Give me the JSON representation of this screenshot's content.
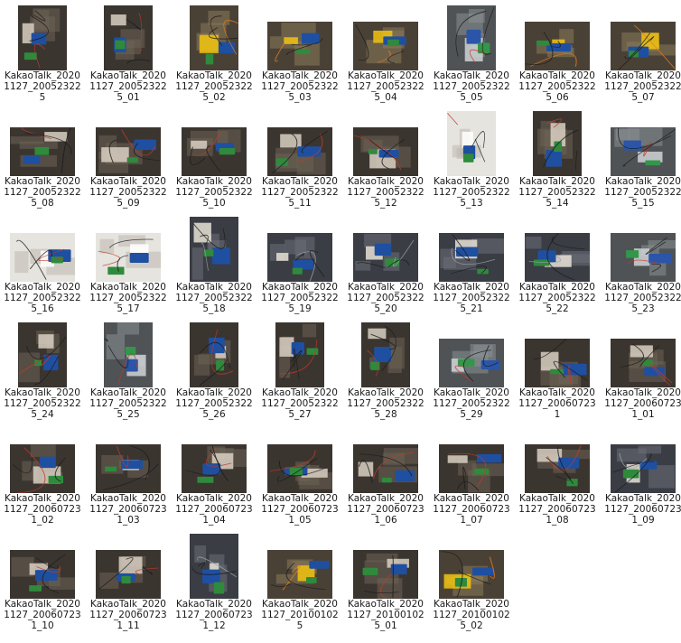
{
  "files": [
    {
      "line1": "KakaoTalk_2020",
      "line2": "1127_20052322",
      "line3": "5",
      "orient": "portrait",
      "palette": "desk"
    },
    {
      "line1": "KakaoTalk_2020",
      "line2": "1127_20052322",
      "line3": "5_01",
      "orient": "portrait",
      "palette": "desk"
    },
    {
      "line1": "KakaoTalk_2020",
      "line2": "1127_20052322",
      "line3": "5_02",
      "orient": "portrait",
      "palette": "yellow"
    },
    {
      "line1": "KakaoTalk_2020",
      "line2": "1127_20052322",
      "line3": "5_03",
      "orient": "landscape",
      "palette": "yellow"
    },
    {
      "line1": "KakaoTalk_2020",
      "line2": "1127_20052322",
      "line3": "5_04",
      "orient": "landscape",
      "palette": "yellow"
    },
    {
      "line1": "KakaoTalk_2020",
      "line2": "1127_20052322",
      "line3": "5_05",
      "orient": "portrait",
      "palette": "gray"
    },
    {
      "line1": "KakaoTalk_2020",
      "line2": "1127_20052322",
      "line3": "5_06",
      "orient": "landscape",
      "palette": "yellow"
    },
    {
      "line1": "KakaoTalk_2020",
      "line2": "1127_20052322",
      "line3": "5_07",
      "orient": "landscape",
      "palette": "yellow"
    },
    {
      "line1": "KakaoTalk_2020",
      "line2": "1127_20052322",
      "line3": "5_08",
      "orient": "landscape",
      "palette": "desk"
    },
    {
      "line1": "KakaoTalk_2020",
      "line2": "1127_20052322",
      "line3": "5_09",
      "orient": "landscape",
      "palette": "desk"
    },
    {
      "line1": "KakaoTalk_2020",
      "line2": "1127_20052322",
      "line3": "5_10",
      "orient": "landscape",
      "palette": "desk"
    },
    {
      "line1": "KakaoTalk_2020",
      "line2": "1127_20052322",
      "line3": "5_11",
      "orient": "landscape",
      "palette": "desk"
    },
    {
      "line1": "KakaoTalk_2020",
      "line2": "1127_20052322",
      "line3": "5_12",
      "orient": "landscape",
      "palette": "desk"
    },
    {
      "line1": "KakaoTalk_2020",
      "line2": "1127_20052322",
      "line3": "5_13",
      "orient": "portrait",
      "palette": "white"
    },
    {
      "line1": "KakaoTalk_2020",
      "line2": "1127_20052322",
      "line3": "5_14",
      "orient": "portrait",
      "palette": "desk"
    },
    {
      "line1": "KakaoTalk_2020",
      "line2": "1127_20052322",
      "line3": "5_15",
      "orient": "landscape",
      "palette": "gray"
    },
    {
      "line1": "KakaoTalk_2020",
      "line2": "1127_20052322",
      "line3": "5_16",
      "orient": "landscape",
      "palette": "white"
    },
    {
      "line1": "KakaoTalk_2020",
      "line2": "1127_20052322",
      "line3": "5_17",
      "orient": "landscape",
      "palette": "white"
    },
    {
      "line1": "KakaoTalk_2020",
      "line2": "1127_20052322",
      "line3": "5_18",
      "orient": "portrait",
      "palette": "keyboard"
    },
    {
      "line1": "KakaoTalk_2020",
      "line2": "1127_20052322",
      "line3": "5_19",
      "orient": "landscape",
      "palette": "keyboard"
    },
    {
      "line1": "KakaoTalk_2020",
      "line2": "1127_20052322",
      "line3": "5_20",
      "orient": "landscape",
      "palette": "keyboard"
    },
    {
      "line1": "KakaoTalk_2020",
      "line2": "1127_20052322",
      "line3": "5_21",
      "orient": "landscape",
      "palette": "keyboard"
    },
    {
      "line1": "KakaoTalk_2020",
      "line2": "1127_20052322",
      "line3": "5_22",
      "orient": "landscape",
      "palette": "keyboard"
    },
    {
      "line1": "KakaoTalk_2020",
      "line2": "1127_20052322",
      "line3": "5_23",
      "orient": "landscape",
      "palette": "gray"
    },
    {
      "line1": "KakaoTalk_2020",
      "line2": "1127_20052322",
      "line3": "5_24",
      "orient": "portrait",
      "palette": "desk"
    },
    {
      "line1": "KakaoTalk_2020",
      "line2": "1127_20052322",
      "line3": "5_25",
      "orient": "portrait",
      "palette": "gray"
    },
    {
      "line1": "KakaoTalk_2020",
      "line2": "1127_20052322",
      "line3": "5_26",
      "orient": "portrait",
      "palette": "desk"
    },
    {
      "line1": "KakaoTalk_2020",
      "line2": "1127_20052322",
      "line3": "5_27",
      "orient": "portrait",
      "palette": "desk"
    },
    {
      "line1": "KakaoTalk_2020",
      "line2": "1127_20052322",
      "line3": "5_28",
      "orient": "portrait",
      "palette": "desk"
    },
    {
      "line1": "KakaoTalk_2020",
      "line2": "1127_20052322",
      "line3": "5_29",
      "orient": "landscape",
      "palette": "gray"
    },
    {
      "line1": "KakaoTalk_2020",
      "line2": "1127_20060723",
      "line3": "1",
      "orient": "landscape",
      "palette": "desk"
    },
    {
      "line1": "KakaoTalk_2020",
      "line2": "1127_20060723",
      "line3": "1_01",
      "orient": "landscape",
      "palette": "desk"
    },
    {
      "line1": "KakaoTalk_2020",
      "line2": "1127_20060723",
      "line3": "1_02",
      "orient": "landscape",
      "palette": "desk"
    },
    {
      "line1": "KakaoTalk_2020",
      "line2": "1127_20060723",
      "line3": "1_03",
      "orient": "landscape",
      "palette": "desk"
    },
    {
      "line1": "KakaoTalk_2020",
      "line2": "1127_20060723",
      "line3": "1_04",
      "orient": "landscape",
      "palette": "desk"
    },
    {
      "line1": "KakaoTalk_2020",
      "line2": "1127_20060723",
      "line3": "1_05",
      "orient": "landscape",
      "palette": "desk"
    },
    {
      "line1": "KakaoTalk_2020",
      "line2": "1127_20060723",
      "line3": "1_06",
      "orient": "landscape",
      "palette": "desk"
    },
    {
      "line1": "KakaoTalk_2020",
      "line2": "1127_20060723",
      "line3": "1_07",
      "orient": "landscape",
      "palette": "desk"
    },
    {
      "line1": "KakaoTalk_2020",
      "line2": "1127_20060723",
      "line3": "1_08",
      "orient": "landscape",
      "palette": "desk"
    },
    {
      "line1": "KakaoTalk_2020",
      "line2": "1127_20060723",
      "line3": "1_09",
      "orient": "landscape",
      "palette": "keyboard"
    },
    {
      "line1": "KakaoTalk_2020",
      "line2": "1127_20060723",
      "line3": "1_10",
      "orient": "landscape",
      "palette": "desk"
    },
    {
      "line1": "KakaoTalk_2020",
      "line2": "1127_20060723",
      "line3": "1_11",
      "orient": "landscape",
      "palette": "desk"
    },
    {
      "line1": "KakaoTalk_2020",
      "line2": "1127_20060723",
      "line3": "1_12",
      "orient": "portrait",
      "palette": "keyboard"
    },
    {
      "line1": "KakaoTalk_2020",
      "line2": "1127_20100102",
      "line3": "5",
      "orient": "landscape",
      "palette": "yellow"
    },
    {
      "line1": "KakaoTalk_2020",
      "line2": "1127_20100102",
      "line3": "5_01",
      "orient": "landscape",
      "palette": "desk"
    },
    {
      "line1": "KakaoTalk_2020",
      "line2": "1127_20100102",
      "line3": "5_02",
      "orient": "landscape",
      "palette": "yellow"
    }
  ],
  "palettes": {
    "desk": {
      "bg": "#3b3530",
      "mid": "#6d6256",
      "board": "#2f8a3c",
      "accent": "#1f4fa0",
      "wire": "#c0392b",
      "hi": "#d9cfc2"
    },
    "yellow": {
      "bg": "#4a4136",
      "mid": "#8a7a5a",
      "board": "#2f8a3c",
      "accent": "#1f4fa0",
      "wire": "#e67e22",
      "hi": "#f1c40f"
    },
    "gray": {
      "bg": "#4f5356",
      "mid": "#8a8f93",
      "board": "#34964a",
      "accent": "#2a55a8",
      "wire": "#c0392b",
      "hi": "#cfd3d6"
    },
    "white": {
      "bg": "#e6e4df",
      "mid": "#bdb8ae",
      "board": "#2f8a3c",
      "accent": "#1f4fa0",
      "wire": "#c0392b",
      "hi": "#ffffff"
    },
    "keyboard": {
      "bg": "#3a3d44",
      "mid": "#6b7079",
      "board": "#2f8a3c",
      "accent": "#1f4fa0",
      "wire": "#9aa0a8",
      "hi": "#e7e2d6"
    }
  }
}
